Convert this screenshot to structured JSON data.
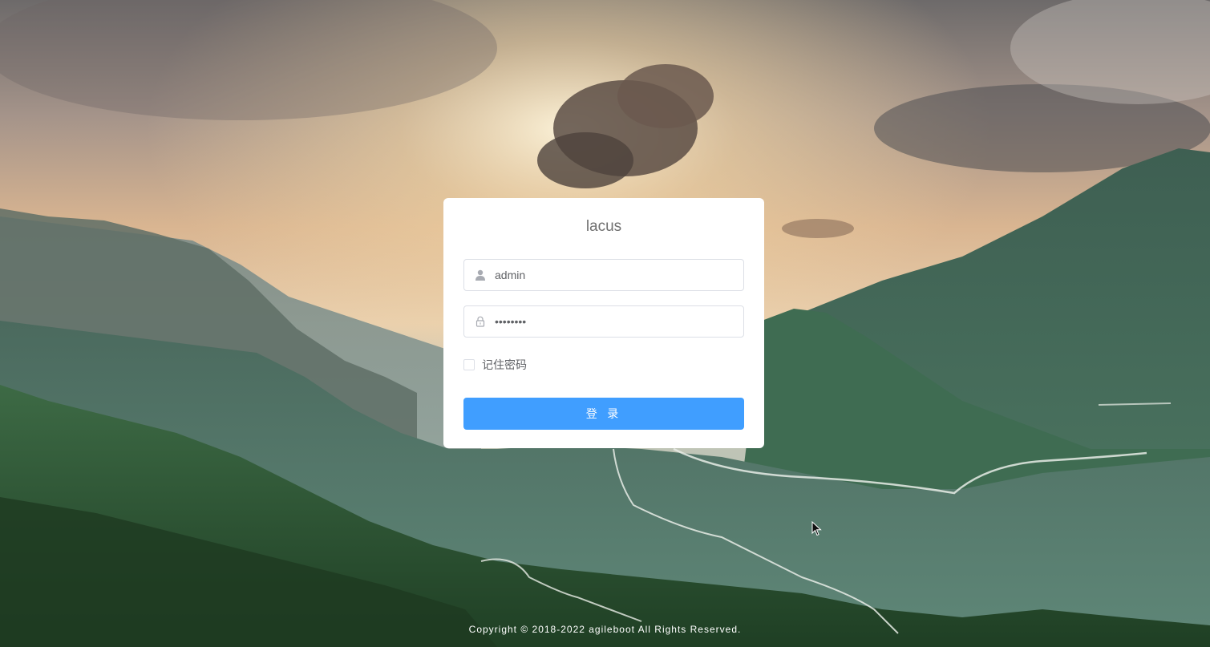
{
  "app": {
    "title": "lacus"
  },
  "login_form": {
    "username": {
      "value": "admin",
      "icon": "user-icon"
    },
    "password": {
      "value": "admin123",
      "icon": "lock-icon"
    },
    "remember": {
      "label": "记住密码",
      "checked": false
    },
    "submit_label": "登 录"
  },
  "footer": {
    "copyright": "Copyright © 2018-2022 agileboot All Rights Reserved."
  },
  "theme": {
    "primary": "#409eff",
    "card_bg": "#ffffff",
    "text": "#606266",
    "title_text": "#707070",
    "border": "#dcdfe6"
  }
}
